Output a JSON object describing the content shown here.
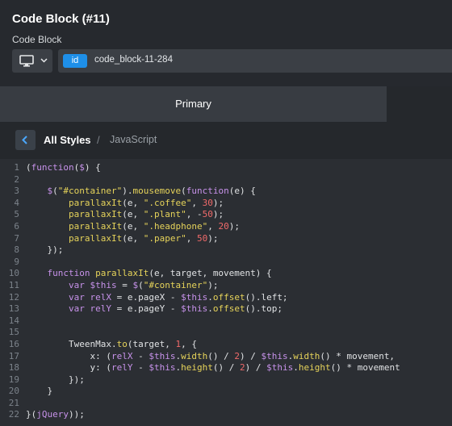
{
  "header": {
    "title": "Code Block (#11)",
    "subtitle": "Code Block",
    "device_icon": "monitor-icon",
    "id_badge": "id",
    "id_value": "code_block-11-284"
  },
  "tabs": {
    "primary": "Primary"
  },
  "breadcrumb": {
    "all_styles": "All Styles",
    "separator": "/",
    "current": "JavaScript"
  },
  "code": {
    "line_numbers": [
      "1",
      "2",
      "3",
      "4",
      "5",
      "6",
      "7",
      "8",
      "9",
      "10",
      "11",
      "12",
      "13",
      "14",
      "15",
      "16",
      "17",
      "18",
      "19",
      "20",
      "21",
      "22"
    ],
    "lines": [
      "(function($) {",
      "",
      "    $(\"#container\").mousemove(function(e) {",
      "        parallaxIt(e, \".coffee\", 30);",
      "        parallaxIt(e, \".plant\", -50);",
      "        parallaxIt(e, \".headphone\", 20);",
      "        parallaxIt(e, \".paper\", 50);",
      "    });",
      "",
      "    function parallaxIt(e, target, movement) {",
      "        var $this = $(\"#container\");",
      "        var relX = e.pageX - $this.offset().left;",
      "        var relY = e.pageY - $this.offset().top;",
      "",
      "",
      "        TweenMax.to(target, 1, {",
      "            x: (relX - $this.width() / 2) / $this.width() * movement,",
      "            y: (relY - $this.height() / 2) / $this.height() * movement",
      "        });",
      "    }",
      "",
      "}(jQuery));"
    ]
  },
  "colors": {
    "badge": "#1e8fe8",
    "keyword": "#c792ea",
    "string": "#e6d35a",
    "number": "#f06a6a"
  }
}
